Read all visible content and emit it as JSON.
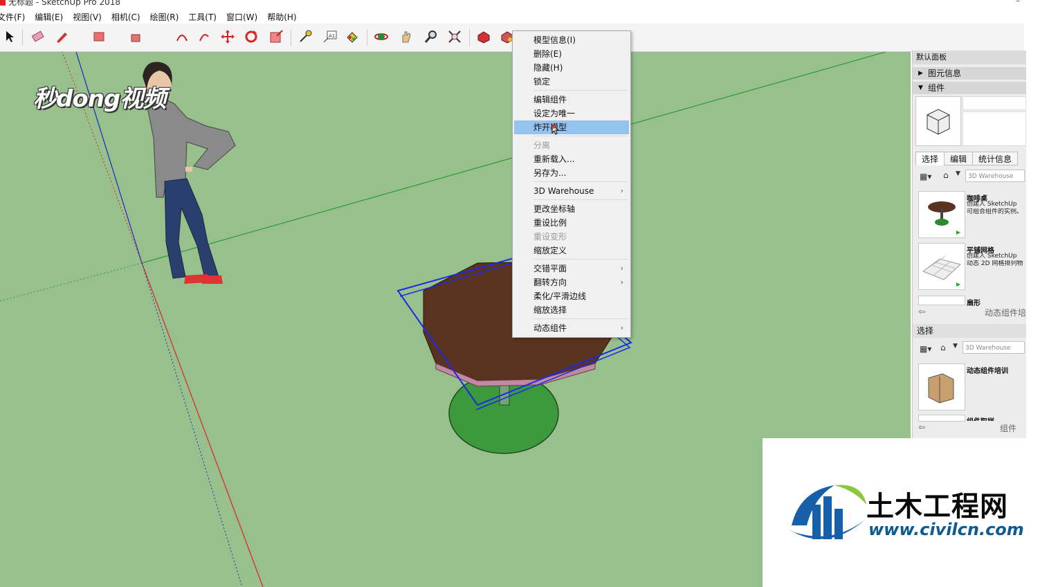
{
  "window": {
    "title": "无标题 - SketchUp Pro 2018",
    "close_glyph": "–"
  },
  "menubar": [
    "文件(F)",
    "编辑(E)",
    "视图(V)",
    "相机(C)",
    "绘图(R)",
    "工具(T)",
    "窗口(W)",
    "帮助(H)"
  ],
  "watermark_top": "秒dong视频",
  "context_menu": {
    "items": [
      {
        "label": "模型信息(I)",
        "enabled": true
      },
      {
        "label": "删除(E)",
        "enabled": true
      },
      {
        "label": "隐藏(H)",
        "enabled": true
      },
      {
        "label": "锁定",
        "enabled": true
      },
      {
        "label": "编辑组件",
        "enabled": true
      },
      {
        "label": "设定为唯一",
        "enabled": true
      },
      {
        "label": "炸开模型",
        "enabled": true,
        "highlighted": true
      },
      {
        "label": "分离",
        "enabled": false
      },
      {
        "label": "重新载入...",
        "enabled": true
      },
      {
        "label": "另存为...",
        "enabled": true
      },
      {
        "label": "3D Warehouse",
        "enabled": true,
        "submenu": true
      },
      {
        "label": "更改坐标轴",
        "enabled": true
      },
      {
        "label": "重设比例",
        "enabled": true
      },
      {
        "label": "重设变形",
        "enabled": false
      },
      {
        "label": "缩放定义",
        "enabled": true
      },
      {
        "label": "交错平面",
        "enabled": true,
        "submenu": true
      },
      {
        "label": "翻转方向",
        "enabled": true,
        "submenu": true
      },
      {
        "label": "柔化/平滑边线",
        "enabled": true
      },
      {
        "label": "缩放选择",
        "enabled": true
      },
      {
        "label": "动态组件",
        "enabled": true,
        "submenu": true
      }
    ],
    "submenu_arrow": "›"
  },
  "panel": {
    "header": "默认面板",
    "tray_entity_info": "图元信息",
    "tray_components": "组件",
    "tabs": [
      "选择",
      "编辑",
      "统计信息"
    ],
    "search_placeholder": "3D Warehouse",
    "components": [
      {
        "title": "咖啡桌",
        "desc": [
          "创建人 SketchUp",
          "可组合组件的实例。"
        ]
      },
      {
        "title": "平铺网格",
        "desc": [
          "创建人 SketchUp",
          "动态 2D 网格排列物"
        ]
      },
      {
        "title": "扇形",
        "desc": []
      }
    ],
    "nav_label_1": "动态组件培",
    "section2_label": "选择",
    "search2_placeholder": "3D Warehouse",
    "components2": [
      {
        "title": "动态组件培训"
      },
      {
        "title": "组件取样"
      }
    ],
    "nav_label_2": "组件"
  },
  "logo": {
    "cn": "土木工程网",
    "url": "www.civilcn.com"
  },
  "colors": {
    "viewport": "#97c08c",
    "menu_highlight": "#93c3ee",
    "logo_blue": "#0f5a8f",
    "logo_green": "#8cc63f"
  }
}
